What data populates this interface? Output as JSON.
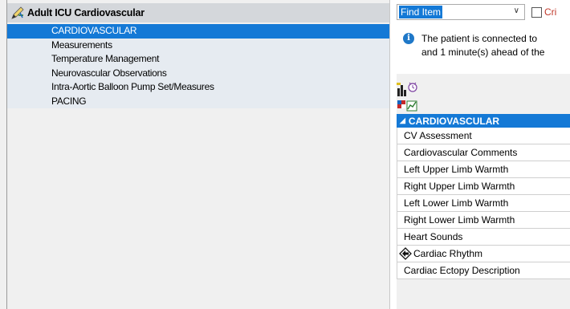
{
  "navigator": {
    "title": "Adult ICU Cardiovascular",
    "items": [
      {
        "label": "CARDIOVASCULAR",
        "selected": true
      },
      {
        "label": "Measurements",
        "selected": false
      },
      {
        "label": "Temperature Management",
        "selected": false
      },
      {
        "label": "Neurovascular Observations",
        "selected": false
      },
      {
        "label": "Intra-Aortic Balloon Pump Set/Measures",
        "selected": false
      },
      {
        "label": "PACING",
        "selected": false
      }
    ]
  },
  "toolbar": {
    "find_item_value": "Find Item",
    "critical_label": "Cri"
  },
  "info": {
    "line1": "The patient is connected to",
    "line2": "and 1 minute(s) ahead of the"
  },
  "grid": {
    "section_title": "CARDIOVASCULAR",
    "rows": [
      {
        "label": "CV Assessment"
      },
      {
        "label": "Cardiovascular Comments"
      },
      {
        "label": "Left Upper Limb Warmth"
      },
      {
        "label": "Right Upper Limb Warmth"
      },
      {
        "label": "Left Lower Limb Warmth"
      },
      {
        "label": "Right Lower Limb Warmth"
      },
      {
        "label": "Heart Sounds"
      },
      {
        "label": "Cardiac Rhythm"
      },
      {
        "label": "Cardiac Ectopy Description"
      }
    ]
  },
  "colors": {
    "selection": "#1479d6",
    "critical": "#c0392b",
    "info": "#1f78c8"
  }
}
